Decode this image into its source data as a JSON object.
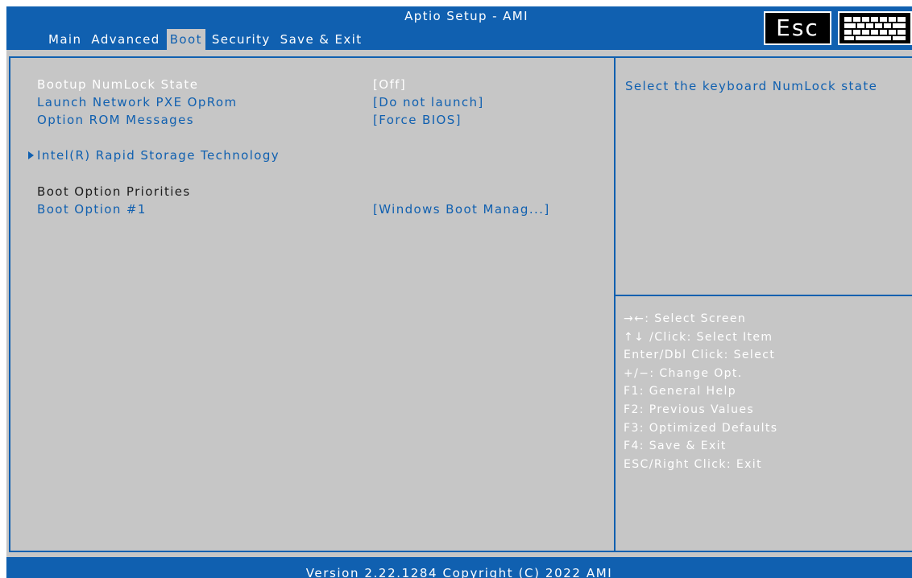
{
  "header": {
    "title": "Aptio Setup - AMI",
    "tabs": [
      {
        "label": "Main"
      },
      {
        "label": "Advanced"
      },
      {
        "label": "Boot"
      },
      {
        "label": "Security"
      },
      {
        "label": "Save & Exit"
      }
    ],
    "active_tab": "Boot",
    "esc_label": "Esc",
    "keyboard_icon": "keyboard-icon"
  },
  "settings": {
    "numlock": {
      "label": "Bootup NumLock State",
      "value": "[Off]"
    },
    "pxe": {
      "label": "Launch Network PXE OpRom",
      "value": "[Do not launch]"
    },
    "oprom": {
      "label": "Option ROM Messages",
      "value": "[Force BIOS]"
    },
    "rst": {
      "label": "Intel(R) Rapid Storage Technology"
    },
    "priorities": {
      "label": "Boot Option Priorities"
    },
    "boot1": {
      "label": "Boot Option #1",
      "value": "[Windows Boot Manag...]"
    }
  },
  "help": {
    "description": "Select the keyboard NumLock state",
    "keys": [
      "→←: Select Screen",
      "↑↓ /Click: Select Item",
      "Enter/Dbl Click: Select",
      "+/−: Change Opt.",
      "F1: General Help",
      "F2: Previous Values",
      "F3: Optimized Defaults",
      "F4: Save & Exit",
      "ESC/Right Click: Exit"
    ]
  },
  "footer": {
    "version": "Version 2.22.1284 Copyright (C) 2022 AMI"
  },
  "colors": {
    "accent": "#1060b0",
    "background": "#c6c6c6",
    "selected_text": "#ffffff"
  }
}
